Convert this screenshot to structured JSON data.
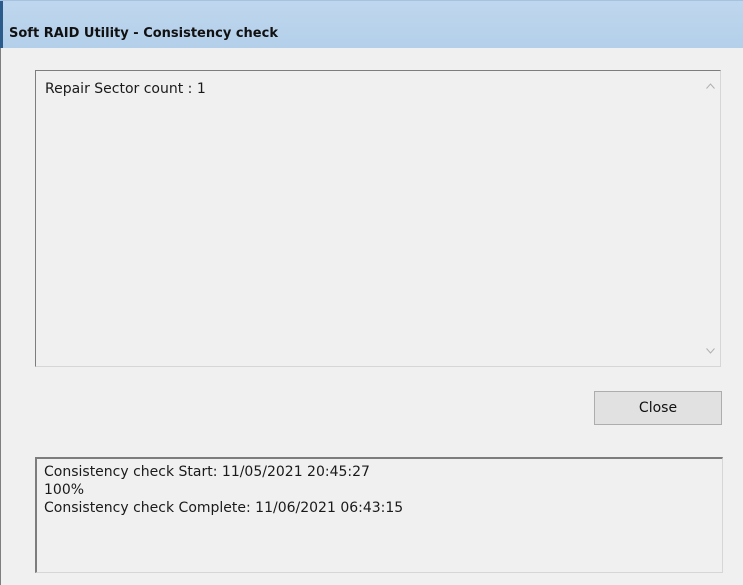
{
  "window": {
    "title": "Soft RAID Utility - Consistency check"
  },
  "log": {
    "text": "Repair Sector count : 1",
    "scroll_up_icon": "chevron-up-icon",
    "scroll_down_icon": "chevron-down-icon"
  },
  "buttons": {
    "close_label": "Close"
  },
  "status": {
    "lines": [
      "Consistency check Start: 11/05/2021 20:45:27",
      "100%",
      "Consistency check Complete: 11/06/2021 06:43:15"
    ]
  },
  "colors": {
    "titlebar": "#bfd7ee",
    "window_bg": "#f0f0f0",
    "button_bg": "#e1e1e1"
  }
}
